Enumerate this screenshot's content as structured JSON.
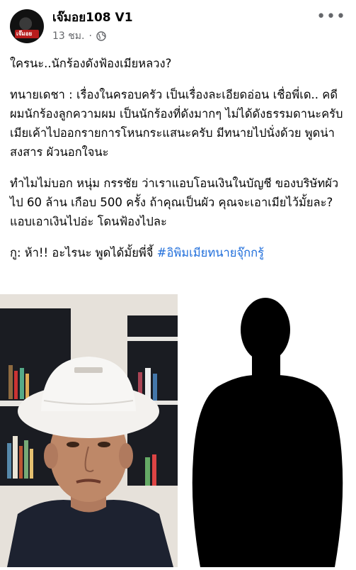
{
  "post": {
    "page_name": "เจ๊มอย108 V1",
    "time": "13 ชม.",
    "separator": "·",
    "privacy_icon": "globe-icon",
    "more_icon": "more-dots-icon",
    "more_label": "•••",
    "avatar_text": "เจ๊มอย"
  },
  "content": {
    "p1": "ใครนะ..นักร้องดังฟ้องเมียหลวง?",
    "p2": "ทนายเดชา : เรื่องในครอบครัว เป็นเรื่องละเอียดอ่อน เชื่อพี่เด.. คดีผมนักร้องลูกความผม เป็นนักร้องที่ดังมากๆ ไม่ได้ดังธรรมดานะครับ เมียเค้าไปออกรายการโหนกระแสนะครับ มีทนายไปนั่งด้วย พูดน่าสงสาร ผัวนอกใจนะ",
    "p3": "ทำไมไม่บอก หนุ่ม กรรชัย ว่าเราแอบโอนเงินในบัญชี ของบริษัทผัวไป 60 ล้าน เกือบ 500 ครั้ง ถ้าคุณเป็นผัว คุณจะเอาเมียไว้มั้ยละ? แอบเอาเงินไปอ่ะ โดนฟ้องไปละ",
    "p4_prefix": "กู: ห้า!! อะไรนะ พูดได้มั้ยพี่จี้ ",
    "hashtag": "#อิพิมเมียทนายจุ๊กกรู้"
  },
  "photos": {
    "left_alt": "man-in-white-bucket-hat-photo",
    "right_alt": "silhouette-photo"
  },
  "colors": {
    "hashtag": "#216fdb",
    "meta": "#65676b",
    "text": "#050505"
  }
}
